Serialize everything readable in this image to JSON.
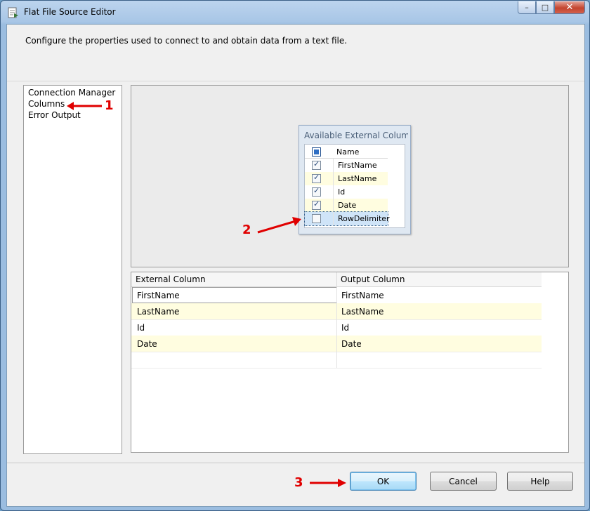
{
  "window": {
    "title": "Flat File Source Editor",
    "caption_buttons": {
      "minimize": "–",
      "maximize": "□",
      "close": "✕"
    }
  },
  "description": "Configure the properties used to connect to and obtain data from a text file.",
  "nav": {
    "items": [
      "Connection Manager",
      "Columns",
      "Error Output"
    ],
    "selected": "Columns"
  },
  "available_columns": {
    "title": "Available External Colum...",
    "header": "Name",
    "header_checked": true,
    "rows": [
      {
        "name": "FirstName",
        "checked": true
      },
      {
        "name": "LastName",
        "checked": true
      },
      {
        "name": "Id",
        "checked": true
      },
      {
        "name": "Date",
        "checked": true
      },
      {
        "name": "RowDelimiter",
        "checked": false
      }
    ]
  },
  "mapping_grid": {
    "headers": [
      "External Column",
      "Output Column"
    ],
    "rows": [
      [
        "FirstName",
        "FirstName"
      ],
      [
        "LastName",
        "LastName"
      ],
      [
        "Id",
        "Id"
      ],
      [
        "Date",
        "Date"
      ]
    ]
  },
  "buttons": {
    "ok": "OK",
    "cancel": "Cancel",
    "help": "Help"
  },
  "annotations": {
    "one": "1",
    "two": "2",
    "three": "3"
  },
  "colors": {
    "annotation_red": "#e00000",
    "row_highlight": "#fffde0",
    "selection_blue": "#cfe4f8"
  }
}
